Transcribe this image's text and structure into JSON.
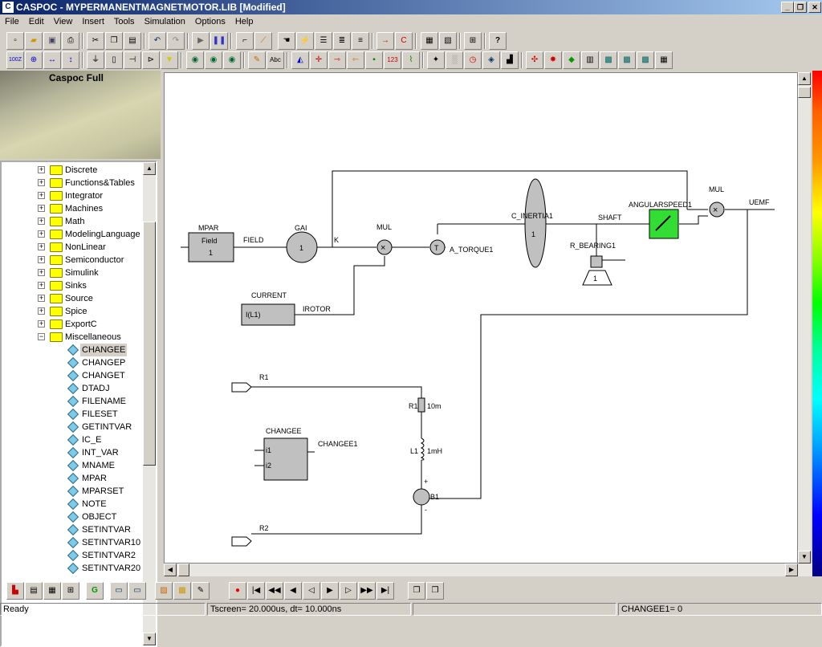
{
  "window": {
    "title": "CASPOC - MYPERMANENTMAGNETMOTOR.LIB [Modified]",
    "controls": [
      "_",
      "❐",
      "✕"
    ]
  },
  "menu": [
    "File",
    "Edit",
    "View",
    "Insert",
    "Tools",
    "Simulation",
    "Options",
    "Help"
  ],
  "panel": {
    "caption": "Caspoc Full"
  },
  "tree": {
    "folders": [
      "Discrete",
      "Functions&Tables",
      "Integrator",
      "Machines",
      "Math",
      "ModelingLanguage",
      "NonLinear",
      "Semiconductor",
      "Simulink",
      "Sinks",
      "Source",
      "Spice",
      "ExportC",
      "Miscellaneous"
    ],
    "items": [
      "CHANGEE",
      "CHANGEP",
      "CHANGET",
      "DTADJ",
      "FILENAME",
      "FILESET",
      "GETINTVAR",
      "IC_E",
      "INT_VAR",
      "MNAME",
      "MPAR",
      "MPARSET",
      "NOTE",
      "OBJECT",
      "SETINTVAR",
      "SETINTVAR10",
      "SETINTVAR2",
      "SETINTVAR20"
    ],
    "selected": "CHANGEE"
  },
  "schematic": {
    "mpar": {
      "title": "MPAR",
      "line1": "Field",
      "line2": "1",
      "out": "FIELD"
    },
    "gain": {
      "title": "GAI",
      "value": "1",
      "out": "K"
    },
    "mul1": {
      "title": "MUL",
      "symbol": "×"
    },
    "torque": {
      "symbol": "T",
      "label": "A_TORQUE1"
    },
    "current": {
      "title": "CURRENT",
      "value": "I(L1)",
      "out": "IROTOR"
    },
    "inertia": {
      "label": "C_INERTIA1",
      "value": "1",
      "shaft": "SHAFT"
    },
    "bearing": {
      "label": "R_BEARING1",
      "value": "1"
    },
    "speed": {
      "label": "ANGULARSPEED1"
    },
    "mul2": {
      "title": "MUL",
      "symbol": "×",
      "out": "UEMF"
    },
    "r1node": "R1",
    "r2node": "R2",
    "resistor": {
      "name": "R1",
      "value": "10m"
    },
    "inductor": {
      "name": "L1",
      "value": "1mH"
    },
    "source": {
      "name": "B1",
      "plus": "+",
      "minus": "-"
    },
    "changee": {
      "title": "CHANGEE",
      "in1": "i1",
      "in2": "i2",
      "out": "CHANGEE1"
    }
  },
  "status": {
    "left": "Ready",
    "middle": "Tscreen= 20.000us, dt= 10.000ns",
    "right": "CHANGEE1=    0"
  },
  "toolbar_labels": {
    "zoom100": "100Z",
    "abc": "Abc",
    "counter": "123",
    "help": "?"
  }
}
